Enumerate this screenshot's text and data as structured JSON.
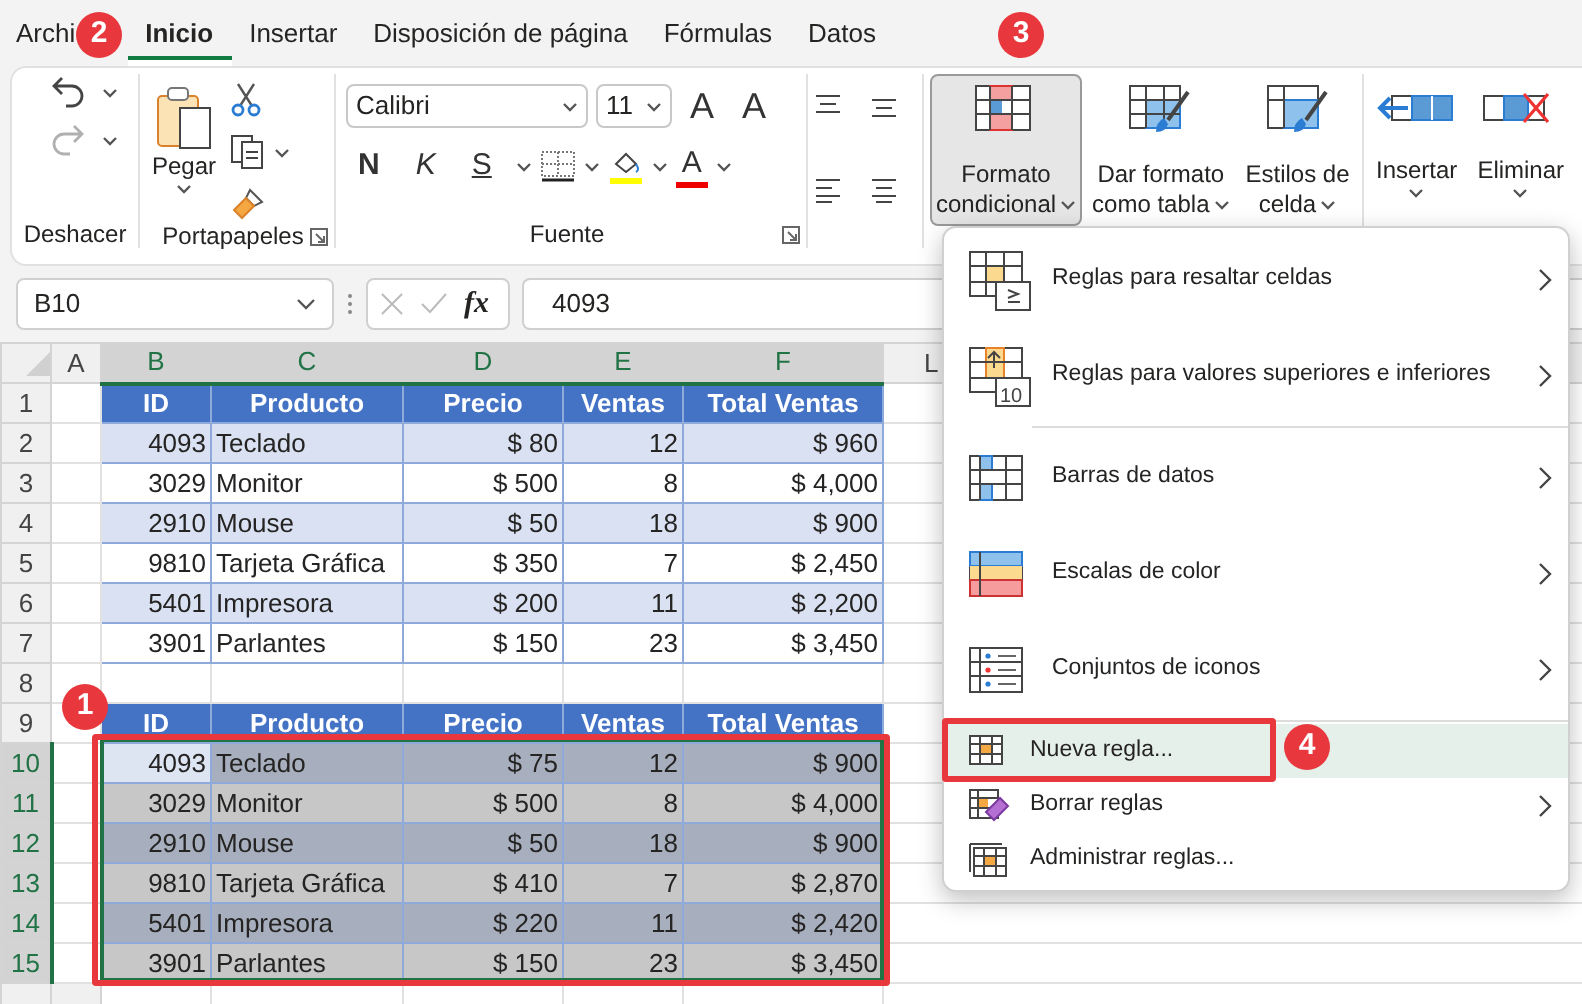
{
  "tabs": [
    {
      "label": "Archi",
      "selected": false
    },
    {
      "label": "Inicio",
      "selected": true
    },
    {
      "label": "Insertar",
      "selected": false
    },
    {
      "label": "Disposición de página",
      "selected": false
    },
    {
      "label": "Fórmulas",
      "selected": false
    },
    {
      "label": "Datos",
      "selected": false
    }
  ],
  "ribbon": {
    "undo": {
      "label": "Deshacer",
      "redo_disabled": true
    },
    "clipboard": {
      "label": "Portapapeles",
      "paste": "Pegar"
    },
    "font": {
      "label": "Fuente",
      "font_name": "Calibri",
      "font_size": "11",
      "size_buttons": [
        "A",
        "A"
      ],
      "format_buttons": [
        "N",
        "K",
        "S"
      ],
      "color_button": "A"
    },
    "styles": [
      {
        "lines": [
          "Formato",
          "condicional"
        ],
        "pressed": true
      },
      {
        "lines": [
          "Dar formato",
          "como tabla"
        ],
        "pressed": false
      },
      {
        "lines": [
          "Estilos de",
          "celda"
        ],
        "pressed": false
      }
    ],
    "cells": [
      {
        "label": "Insertar"
      },
      {
        "label": "Eliminar"
      }
    ]
  },
  "formula_bar": {
    "name_box": "B10",
    "function_label": "fx",
    "value": "4093"
  },
  "sheet": {
    "columns": [
      {
        "label": "A",
        "selected": false
      },
      {
        "label": "B",
        "selected": true
      },
      {
        "label": "C",
        "selected": true
      },
      {
        "label": "D",
        "selected": true
      },
      {
        "label": "E",
        "selected": true
      },
      {
        "label": "F",
        "selected": true
      },
      {
        "label": "L",
        "selected": false
      }
    ],
    "rows": [
      {
        "number": "1",
        "kind": "header",
        "selected": false,
        "cells": [
          "ID",
          "Producto",
          "Precio",
          "Ventas",
          "Total Ventas"
        ]
      },
      {
        "number": "2",
        "kind": "band",
        "selected": false,
        "cells": [
          "4093",
          "Teclado",
          "$ 80",
          "12",
          "$ 960"
        ]
      },
      {
        "number": "3",
        "kind": "plain",
        "selected": false,
        "cells": [
          "3029",
          "Monitor",
          "$ 500",
          "8",
          "$ 4,000"
        ]
      },
      {
        "number": "4",
        "kind": "band",
        "selected": false,
        "cells": [
          "2910",
          "Mouse",
          "$ 50",
          "18",
          "$ 900"
        ]
      },
      {
        "number": "5",
        "kind": "plain",
        "selected": false,
        "cells": [
          "9810",
          "Tarjeta Gráfica",
          "$ 350",
          "7",
          "$ 2,450"
        ]
      },
      {
        "number": "6",
        "kind": "band",
        "selected": false,
        "cells": [
          "5401",
          "Impresora",
          "$ 200",
          "11",
          "$ 2,200"
        ]
      },
      {
        "number": "7",
        "kind": "plain",
        "selected": false,
        "cells": [
          "3901",
          "Parlantes",
          "$ 150",
          "23",
          "$ 3,450"
        ]
      },
      {
        "number": "8",
        "kind": "empty",
        "selected": false
      },
      {
        "number": "9",
        "kind": "header",
        "selected": false,
        "cells": [
          "ID",
          "Producto",
          "Precio",
          "Ventas",
          "Total Ventas"
        ]
      },
      {
        "number": "10",
        "kind": "band",
        "selected": true,
        "active": true,
        "cells": [
          "4093",
          "Teclado",
          "$ 75",
          "12",
          "$ 900"
        ]
      },
      {
        "number": "11",
        "kind": "plain",
        "selected": true,
        "cells": [
          "3029",
          "Monitor",
          "$ 500",
          "8",
          "$ 4,000"
        ]
      },
      {
        "number": "12",
        "kind": "band",
        "selected": true,
        "cells": [
          "2910",
          "Mouse",
          "$ 50",
          "18",
          "$ 900"
        ]
      },
      {
        "number": "13",
        "kind": "plain",
        "selected": true,
        "cells": [
          "9810",
          "Tarjeta Gráfica",
          "$ 410",
          "7",
          "$ 2,870"
        ]
      },
      {
        "number": "14",
        "kind": "band",
        "selected": true,
        "cells": [
          "5401",
          "Impresora",
          "$ 220",
          "11",
          "$ 2,420"
        ]
      },
      {
        "number": "15",
        "kind": "plain",
        "selected": true,
        "cells": [
          "3901",
          "Parlantes",
          "$ 150",
          "23",
          "$ 3,450"
        ]
      }
    ]
  },
  "menu": {
    "sections": [
      [
        {
          "label": "Reglas para resaltar celdas",
          "kind": "large",
          "submenu": true,
          "selected": false
        },
        {
          "label": "Reglas para valores superiores e inferiores",
          "kind": "large",
          "submenu": true,
          "selected": false,
          "icon_text": "10"
        }
      ],
      [
        {
          "label": "Barras de datos",
          "kind": "large",
          "submenu": true,
          "selected": false
        },
        {
          "label": "Escalas de color",
          "kind": "large",
          "submenu": true,
          "selected": false
        },
        {
          "label": "Conjuntos de iconos",
          "kind": "large",
          "submenu": true,
          "selected": false
        }
      ],
      [
        {
          "label": "Nueva regla...",
          "kind": "small",
          "submenu": false,
          "selected": true
        },
        {
          "label": "Borrar reglas",
          "kind": "small",
          "submenu": true,
          "selected": false
        },
        {
          "label": "Administrar reglas...",
          "kind": "small",
          "submenu": false,
          "selected": false
        }
      ]
    ]
  },
  "annotations": [
    {
      "label": "1"
    },
    {
      "label": "2"
    },
    {
      "label": "3"
    },
    {
      "label": "4"
    }
  ]
}
